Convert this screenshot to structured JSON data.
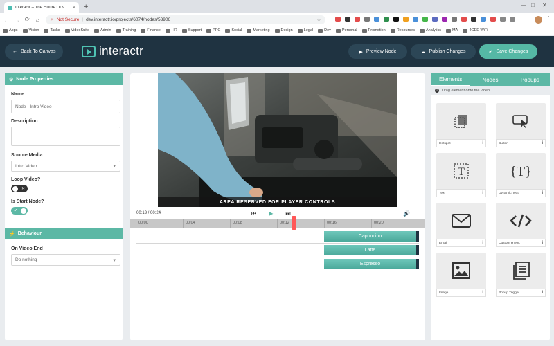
{
  "browser": {
    "tab_title": "Interactr – The Future Of V",
    "tab_close": "×",
    "new_tab": "+",
    "security_label": "Not Secure",
    "url": "dev.interactr.io/projects/6074/nodes/53906",
    "back_icon": "←",
    "forward_icon": "→",
    "reload_icon": "⟳",
    "home_icon": "⌂",
    "bookmarks": [
      "Apps",
      "Vision",
      "Tasks",
      "VideoSuite",
      "Admin",
      "Training",
      "Finance",
      "HR",
      "Support",
      "PPC",
      "Social",
      "Marketing",
      "Design",
      "Legal",
      "Dev",
      "Personal",
      "Promotion",
      "Resources",
      "Analytics",
      "MA",
      "4GEE WiFi"
    ],
    "extension_colors": [
      "#e34c4c",
      "#333333",
      "#e34c4c",
      "#777777",
      "#4a90d9",
      "#2f8f4e",
      "#111111",
      "#f0a020",
      "#4a90d9",
      "#46b64a",
      "#5c6bc0",
      "#9c27b0",
      "#777777",
      "#e34c4c",
      "#333333",
      "#4a90d9",
      "#e34c4c",
      "#888888",
      "#888888"
    ]
  },
  "header": {
    "back_label": "Back To Canvas",
    "back_icon": "←",
    "logo_text": "interactr",
    "preview_label": "Preview Node",
    "preview_icon": "▶",
    "publish_label": "Publish Changes",
    "publish_icon": "☁",
    "save_label": "Save Changes",
    "save_icon": "✔"
  },
  "left_panel": {
    "title": "Node Properties",
    "title_icon": "⚙",
    "name_label": "Name",
    "name_value": "Node - Intro Video",
    "description_label": "Description",
    "description_value": "",
    "source_label": "Source Media",
    "source_value": "Intro Video",
    "loop_label": "Loop Video?",
    "loop_on": false,
    "start_label": "Is Start Node?",
    "start_on": true,
    "toggle_off_mark": "✕",
    "toggle_on_mark": "✔",
    "behaviour_title": "Behaviour",
    "behaviour_icon": "⚡",
    "video_end_label": "On Video End",
    "video_end_value": "Do nothing"
  },
  "player": {
    "reserved_text": "AREA RESERVED FOR PLAYER CONTROLS",
    "timecode": "00:13 / 00:24",
    "prev_icon": "⏮",
    "play_icon": "▶",
    "next_icon": "⏭",
    "volume_icon": "🔊",
    "ticks": [
      "00:00",
      "00:04",
      "00:08",
      "00:12",
      "00:16",
      "00:20"
    ],
    "clips": [
      "Cappucino",
      "Latte",
      "Espresso"
    ],
    "clip_color": "#5cb8a5",
    "playhead_color": "#ff5757"
  },
  "right_panel": {
    "tabs": [
      "Elements",
      "Nodes",
      "Popups"
    ],
    "active_tab": 0,
    "hint": "Drag element onto the video",
    "elements": [
      {
        "label": "Hotspot",
        "icon": "hotspot-icon"
      },
      {
        "label": "Button",
        "icon": "button-cursor-icon"
      },
      {
        "label": "Text",
        "icon": "text-icon"
      },
      {
        "label": "Dynamic Text",
        "icon": "dynamic-text-icon"
      },
      {
        "label": "Email",
        "icon": "envelope-icon"
      },
      {
        "label": "Custom HTML",
        "icon": "code-icon"
      },
      {
        "label": "Image",
        "icon": "image-icon"
      },
      {
        "label": "Popup Trigger",
        "icon": "popup-trigger-icon"
      }
    ],
    "info_mark": "i"
  },
  "colors": {
    "header_bg": "#1f3341",
    "accent": "#5cb8a5"
  }
}
